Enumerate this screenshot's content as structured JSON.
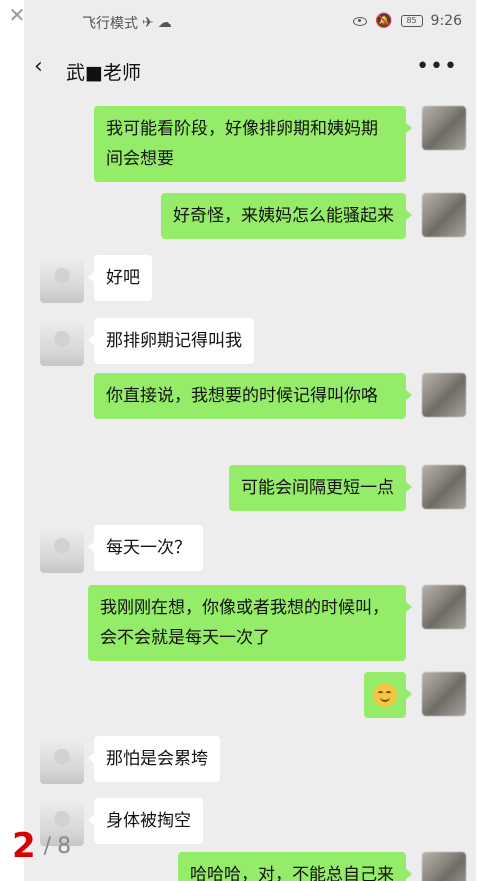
{
  "viewer": {
    "close_icon": "close-icon",
    "page_current": "2",
    "page_separator": "/",
    "page_total": "8"
  },
  "status_bar": {
    "mode_text": "飞行模式",
    "time": "9:26",
    "battery": "85"
  },
  "chat": {
    "title": "武■老师",
    "messages": [
      {
        "side": "right",
        "text": "我可能看阶段，好像排卵期和姨妈期间会想要"
      },
      {
        "side": "right",
        "text": "好奇怪，来姨妈怎么能骚起来"
      },
      {
        "side": "left",
        "text": "好吧"
      },
      {
        "side": "left",
        "text": "那排卵期记得叫我"
      },
      {
        "side": "right",
        "text": "你直接说，我想要的时候记得叫你咯"
      },
      {
        "side": "right",
        "text": "可能会间隔更短一点"
      },
      {
        "side": "left",
        "text": "每天一次？"
      },
      {
        "side": "right",
        "text": "我刚刚在想，你像或者我想的时候叫，会不会就是每天一次了"
      },
      {
        "side": "right",
        "text": "",
        "emoji": "laughing-emoji"
      },
      {
        "side": "left",
        "text": "那怕是会累垮"
      },
      {
        "side": "left",
        "text": "身体被掏空"
      },
      {
        "side": "right",
        "text": "哈哈哈，对，不能总自己来"
      }
    ]
  }
}
